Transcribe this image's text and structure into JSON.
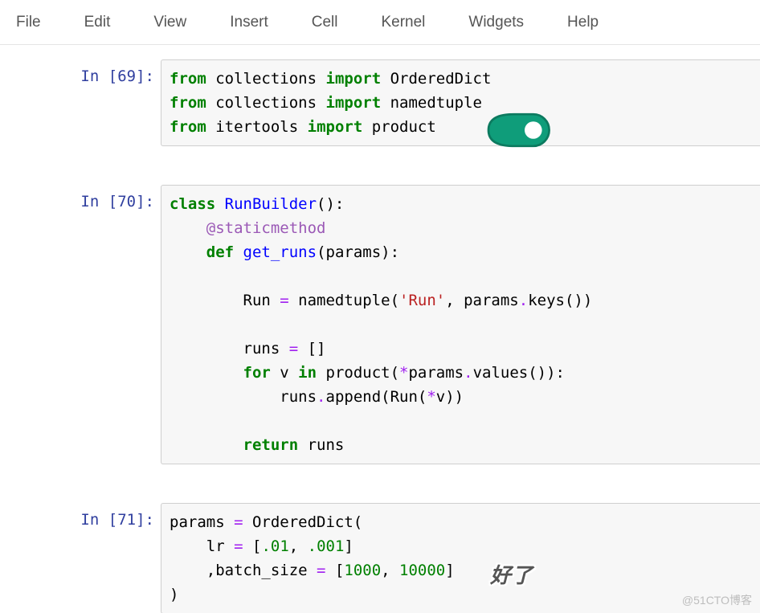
{
  "menu": {
    "items": [
      "File",
      "Edit",
      "View",
      "Insert",
      "Cell",
      "Kernel",
      "Widgets",
      "Help"
    ]
  },
  "cells": [
    {
      "prompt_label": "In",
      "prompt_number": "69",
      "code": {
        "line1_kw1": "from",
        "line1_mod": "collections",
        "line1_kw2": "import",
        "line1_name": "OrderedDict",
        "line2_kw1": "from",
        "line2_mod": "collections",
        "line2_kw2": "import",
        "line2_name": "namedtuple",
        "line3_kw1": "from",
        "line3_mod": "itertools",
        "line3_kw2": "import",
        "line3_name": "product"
      }
    },
    {
      "prompt_label": "In",
      "prompt_number": "70",
      "code": {
        "l1_kw": "class",
        "l1_cls": "RunBuilder",
        "l1_rest": "():",
        "l2_deco": "@staticmethod",
        "l3_kw": "def",
        "l3_fn": "get_runs",
        "l3_rest": "(params):",
        "l5_a": "Run ",
        "l5_op": "=",
        "l5_b": " namedtuple(",
        "l5_str": "'Run'",
        "l5_c": ", params",
        "l5_op2": ".",
        "l5_d": "keys())",
        "l7_a": "runs ",
        "l7_op": "=",
        "l7_b": " []",
        "l8_kw1": "for",
        "l8_mid": " v ",
        "l8_kw2": "in",
        "l8_b": " product(",
        "l8_op": "*",
        "l8_c": "params",
        "l8_op2": ".",
        "l8_d": "values()):",
        "l9_a": "runs",
        "l9_op": ".",
        "l9_b": "append(Run(",
        "l9_op2": "*",
        "l9_c": "v))",
        "l11_kw": "return",
        "l11_b": " runs"
      }
    },
    {
      "prompt_label": "In",
      "prompt_number": "71",
      "code": {
        "l1_a": "params ",
        "l1_op": "=",
        "l1_b": " OrderedDict(",
        "l2_a": "lr ",
        "l2_op": "=",
        "l2_b": " [",
        "l2_n1": ".01",
        "l2_c": ", ",
        "l2_n2": ".001",
        "l2_d": "]",
        "l3_a": ",batch_size ",
        "l3_op": "=",
        "l3_b": " [",
        "l3_n1": "1000",
        "l3_c": ", ",
        "l3_n2": "10000",
        "l3_d": "]",
        "l4": ")"
      }
    }
  ],
  "overlay_caption": "好了",
  "watermark": "@51CTO博客"
}
